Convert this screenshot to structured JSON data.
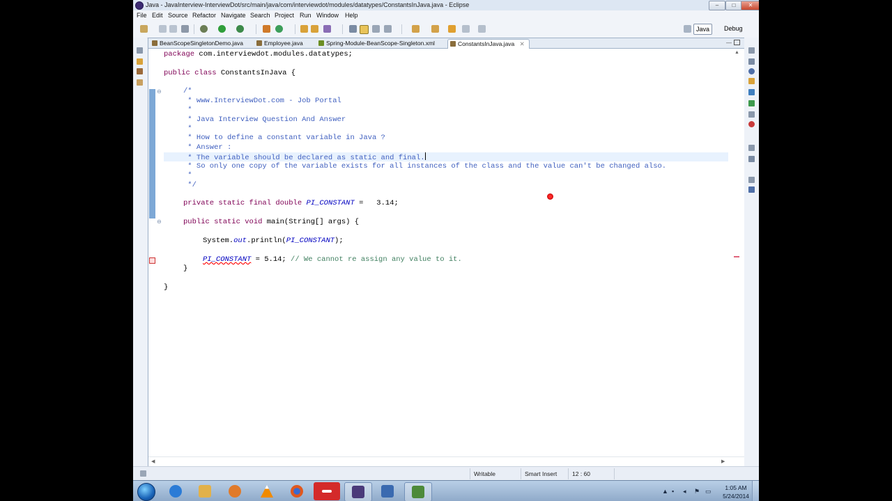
{
  "window": {
    "title": "Java - JavaInterview-InterviewDot/src/main/java/com/interviewdot/modules/datatypes/ConstantsInJava.java - Eclipse",
    "minimize": "–",
    "maximize": "□",
    "close": "✕"
  },
  "menu": [
    "File",
    "Edit",
    "Source",
    "Refactor",
    "Navigate",
    "Search",
    "Project",
    "Run",
    "Window",
    "Help"
  ],
  "perspectives": {
    "java": "Java",
    "debug": "Debug"
  },
  "tabs": [
    {
      "label": "BeanScopeSingletonDemo.java",
      "icon_color": "#8a6d3b"
    },
    {
      "label": "Employee.java",
      "icon_color": "#8a6d3b"
    },
    {
      "label": "Spring-Module-BeanScope-Singleton.xml",
      "icon_color": "#6b8e23"
    },
    {
      "label": "ConstantsInJava.java",
      "icon_color": "#8a6d3b",
      "close": "✕"
    }
  ],
  "code": {
    "l1_kw": "package",
    "l1_rest": " com.interviewdot.modules.datatypes;",
    "l2_kw": "public class",
    "l2_rest": " ConstantsInJava {",
    "c_open": "/*",
    "c_1": " * www.InterviewDot.com - Job Portal",
    "c_2": " *",
    "c_3": " * Java Interview Question And Answer",
    "c_4": " *",
    "c_5": " * How to define a constant variable in Java ?",
    "c_6": " * Answer :",
    "c_7": " * The variable should be declared as static and final.",
    "c_8": " * So only one copy of the variable exists for all instances of the class and the value can't be changed also.",
    "c_9": " *",
    "c_close": " */",
    "f_kw": "private static final double",
    "f_name": "PI_CONSTANT",
    "f_rest": " =   3.14;",
    "m_kw": "public static void",
    "m_rest": " main(String[] args) {",
    "p_a": "System.",
    "p_out": "out",
    "p_b": ".println(",
    "p_arg": "PI_CONSTANT",
    "p_c": ");",
    "a_name": "PI_CONSTANT",
    "a_rest": " = 5.14; ",
    "a_comment": "// We cannot re assign any value to it.",
    "close_method": "}",
    "close_class": "}"
  },
  "status": {
    "writable": "Writable",
    "insert_mode": "Smart Insert",
    "position": "12 : 60"
  },
  "clock": {
    "time": "1:05 AM",
    "date": "5/24/2014"
  },
  "taskbar_apps": [
    {
      "name": "internet-explorer",
      "color": "#2b7bd6"
    },
    {
      "name": "file-explorer",
      "color": "#e2b14a"
    },
    {
      "name": "media-player",
      "color": "#e07a2a"
    },
    {
      "name": "vlc",
      "color": "#f08a00"
    },
    {
      "name": "firefox",
      "color": "#e0581e"
    },
    {
      "name": "filezilla",
      "color": "#d42a2a"
    },
    {
      "name": "eclipse",
      "color": "#4a3a7a"
    },
    {
      "name": "save-app",
      "color": "#3a6ab0"
    },
    {
      "name": "checklist-app",
      "color": "#4d8a3a"
    }
  ]
}
